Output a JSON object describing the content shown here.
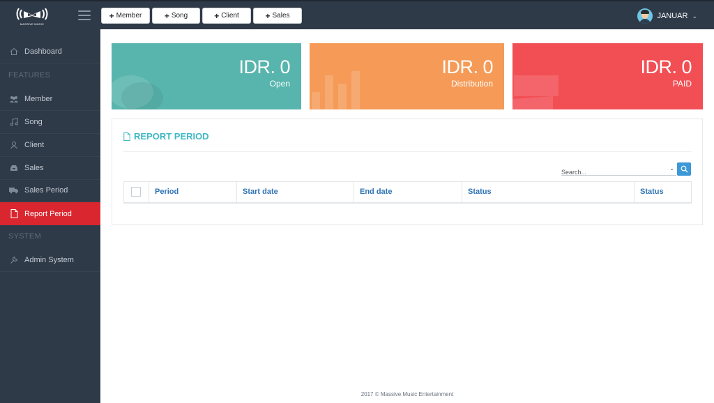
{
  "app": {
    "logo_text": "MASSIVE MUSIC"
  },
  "topbar": {
    "quick_buttons": [
      {
        "label": "Member"
      },
      {
        "label": "Song"
      },
      {
        "label": "Client"
      },
      {
        "label": "Sales"
      }
    ],
    "user_name": "JANUAR",
    "user_chevron": "⌄"
  },
  "sidebar": {
    "items": [
      {
        "label": "Dashboard",
        "icon": "home-icon"
      },
      {
        "label": "Member",
        "icon": "users-icon"
      },
      {
        "label": "Song",
        "icon": "music-note-icon"
      },
      {
        "label": "Client",
        "icon": "client-icon"
      },
      {
        "label": "Sales",
        "icon": "inbox-icon"
      },
      {
        "label": "Sales Period",
        "icon": "truck-icon"
      },
      {
        "label": "Report Period",
        "icon": "document-icon",
        "active": true
      },
      {
        "label": "Admin System",
        "icon": "wrench-icon"
      }
    ],
    "sections": {
      "features": "FEATURES",
      "system": "SYSTEM"
    }
  },
  "cards": [
    {
      "amount": "IDR. 0",
      "label": "Open",
      "color": "#58b5ad"
    },
    {
      "amount": "IDR. 0",
      "label": "Distribution",
      "color": "#f59b57"
    },
    {
      "amount": "IDR. 0",
      "label": "PAID",
      "color": "#f24f55"
    }
  ],
  "report": {
    "title": "REPORT PERIOD",
    "search": {
      "placeholder": "Search...",
      "value": ""
    },
    "columns": [
      "Period",
      "Start date",
      "End date",
      "Status",
      "Status"
    ]
  },
  "footer": {
    "text": "2017 © Massive Music Entertainment"
  },
  "colors": {
    "sidebar_bg": "#2f3a48",
    "active_item": "#d9262f",
    "title_accent": "#3fb8c4",
    "table_header_text": "#2f73b3",
    "search_button": "#3c98d6"
  }
}
